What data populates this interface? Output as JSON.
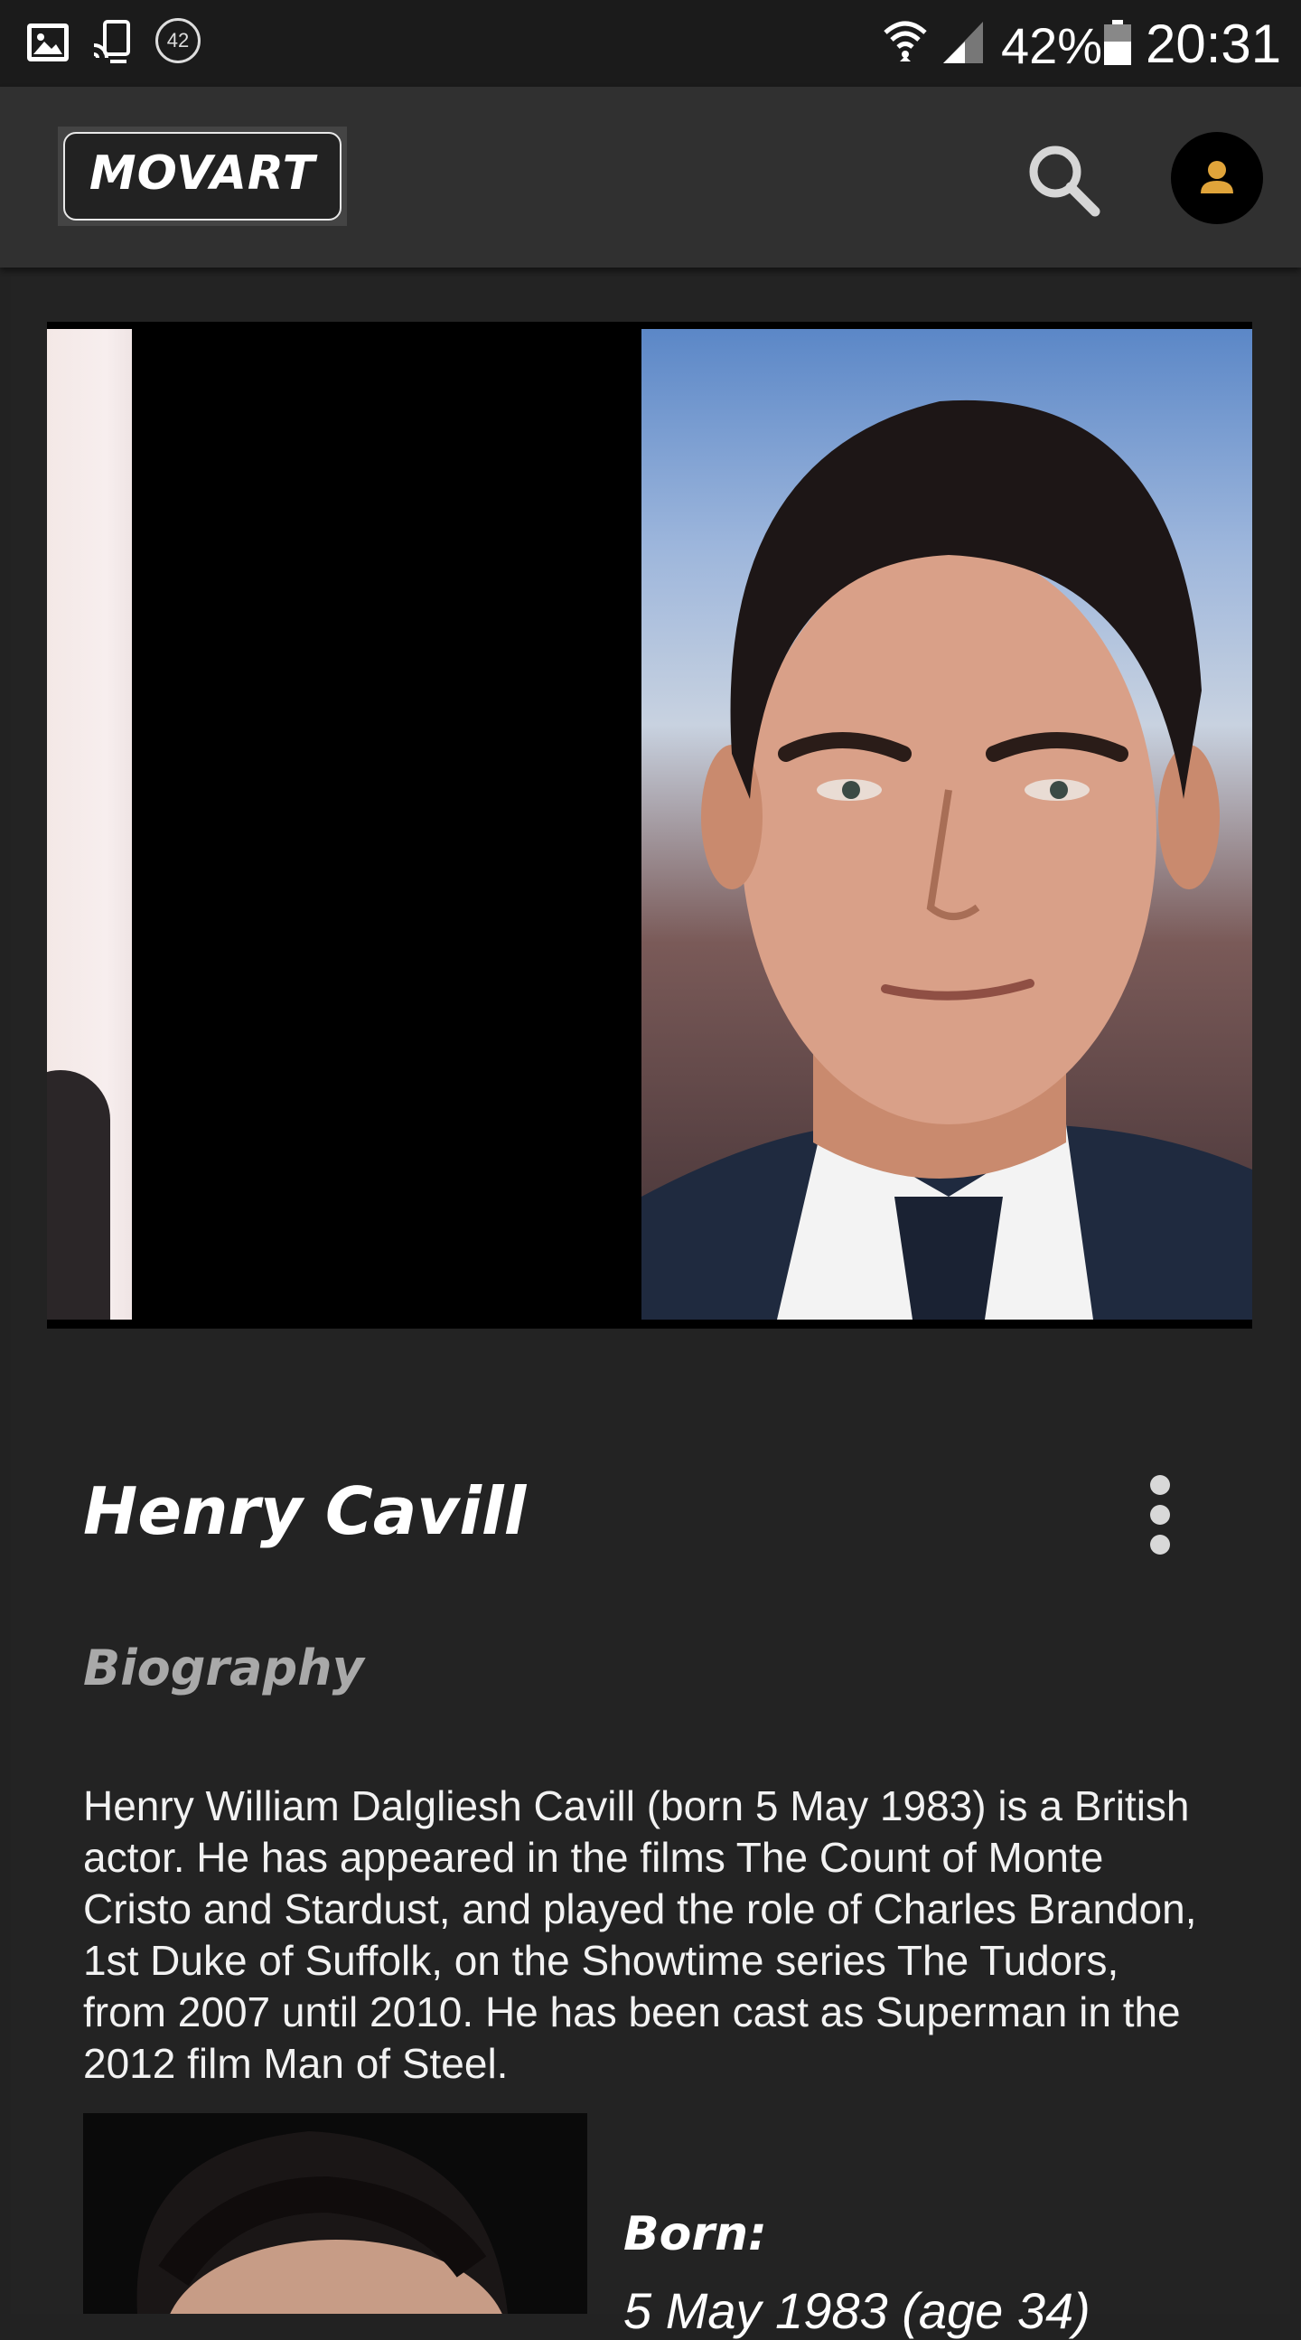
{
  "status_bar": {
    "notification_badge": "42",
    "battery_percent": "42%",
    "time": "20:31",
    "icons": [
      "image-icon",
      "cast-icon",
      "notification-badge-icon",
      "wifi-icon",
      "signal-icon",
      "battery-icon"
    ]
  },
  "app_bar": {
    "logo_text": "MOVART",
    "search_icon": "search-icon",
    "account_icon": "account-icon",
    "accent_color": "#e0a43a"
  },
  "person": {
    "name": "Henry Cavill",
    "section_title": "Biography",
    "biography": "Henry William Dalgliesh Cavill (born 5 May 1983) is a British actor. He has appeared in the films The Count of Monte Cristo and Stardust, and played the role of Charles Brandon, 1st Duke of Suffolk, on the Showtime series The Tudors, from 2007 until 2010. He has been cast as Superman in the 2012 film Man of Steel.",
    "born_label": "Born:",
    "born_value": "5 May 1983 (age 34)"
  },
  "colors": {
    "background": "#222222",
    "app_bar": "#303030",
    "status_bar": "#1b1b1b",
    "section_title": "#a9a9a9"
  }
}
